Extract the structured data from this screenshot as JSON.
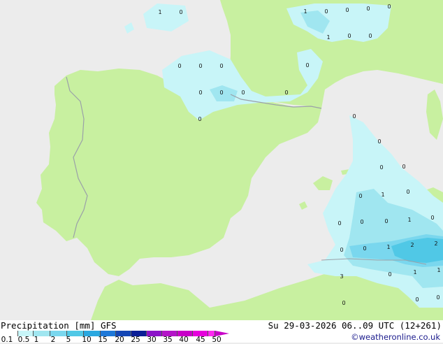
{
  "title": "Precipitation [mm] GFS",
  "datetime": "Su 29-03-2026 06..09 UTC (12+261)",
  "credit": "©weatheronline.co.uk",
  "colors": {
    "sea": "#ececec",
    "land": "#c8f0a0",
    "precip_light": "#c8f5f8",
    "precip_mid": "#a0e6f0",
    "precip_high": "#50c8e6",
    "border": "#9aa0a8"
  },
  "legend": {
    "labels": [
      "0.1",
      "0.5",
      "1",
      "2",
      "5",
      "10",
      "15",
      "20",
      "25",
      "30",
      "35",
      "40",
      "45",
      "50"
    ],
    "colors": [
      "#ffffff",
      "#c8f5f8",
      "#a0e6f0",
      "#7ad7ee",
      "#50c8e6",
      "#2aa8e0",
      "#1e78d8",
      "#1446b4",
      "#0a1e96",
      "#8c14c8",
      "#b414c8",
      "#c800c8",
      "#e600dc",
      "#ff28f0"
    ]
  },
  "values": [
    {
      "t": "1"
    },
    {
      "t": "0"
    },
    {
      "t": "1"
    },
    {
      "t": "0"
    },
    {
      "t": "0"
    },
    {
      "t": "0"
    },
    {
      "t": "0"
    },
    {
      "t": "0"
    },
    {
      "t": "0"
    },
    {
      "t": "0"
    },
    {
      "t": "0"
    },
    {
      "t": "0"
    },
    {
      "t": "0"
    },
    {
      "t": "0"
    },
    {
      "t": "0"
    },
    {
      "t": "1"
    },
    {
      "t": "0"
    },
    {
      "t": "0"
    },
    {
      "t": "0"
    },
    {
      "t": "0"
    },
    {
      "t": "0"
    },
    {
      "t": "0"
    },
    {
      "t": "0"
    },
    {
      "t": "0"
    },
    {
      "t": "1"
    },
    {
      "t": "0"
    },
    {
      "t": "0"
    },
    {
      "t": "0"
    },
    {
      "t": "0"
    },
    {
      "t": "1"
    },
    {
      "t": "0"
    },
    {
      "t": "0"
    },
    {
      "t": "0"
    },
    {
      "t": "1"
    },
    {
      "t": "2"
    },
    {
      "t": "2"
    },
    {
      "t": "3"
    },
    {
      "t": "0"
    },
    {
      "t": "1"
    },
    {
      "t": "1"
    },
    {
      "t": "0"
    },
    {
      "t": "0"
    },
    {
      "t": "0"
    }
  ]
}
